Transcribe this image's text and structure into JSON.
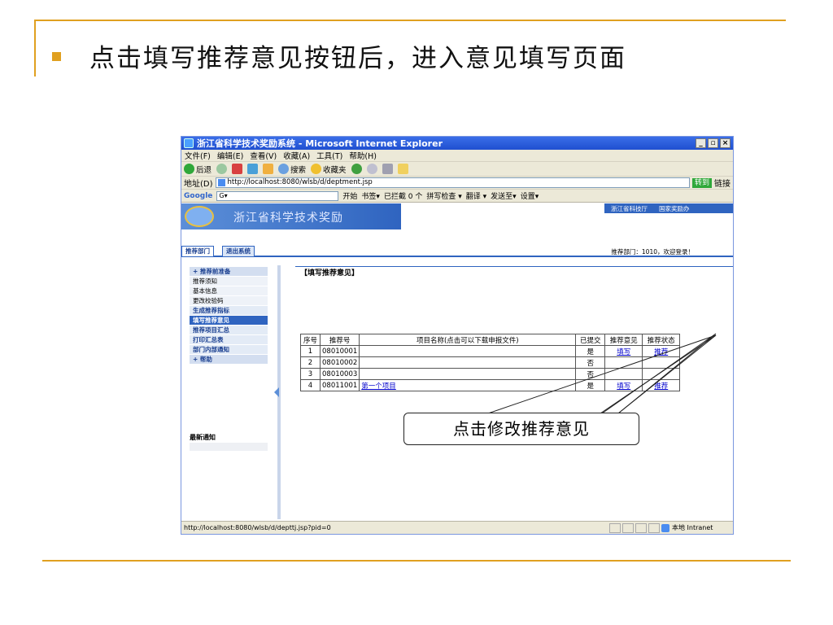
{
  "slide": {
    "heading": "点击填写推荐意见按钮后，进入意见填写页面"
  },
  "browser": {
    "window_title": "浙江省科学技术奖励系统 - Microsoft Internet Explorer",
    "menu": [
      "文件(F)",
      "编辑(E)",
      "查看(V)",
      "收藏(A)",
      "工具(T)",
      "帮助(H)"
    ],
    "toolbar": {
      "back": "后退",
      "search": "搜索",
      "favorites": "收藏夹"
    },
    "address_label": "地址(D)",
    "address_value": "http://localhost:8080/wlsb/d/deptment.jsp",
    "go_label": "转到",
    "links_label": "链接",
    "google": {
      "logo": "Google",
      "input": "G▾",
      "start": "开始",
      "bookmarks": "书签▾",
      "blocked": "已拦截 0 个",
      "spellcheck": "拼写检查 ▾",
      "translate": "翻译 ▾",
      "send": "发送至▾",
      "settings": "设置▾"
    },
    "status_url": "http://localhost:8080/wlsb/d/depttj.jsp?pid=0",
    "status_zone": "本地 Intranet"
  },
  "app": {
    "banner_title": "浙江省科学技术奖励",
    "banner_links": [
      "浙江省科技厅",
      "国家奖励办"
    ],
    "nav_tabs": [
      "推荐部门",
      "退出系统"
    ],
    "welcome": "推荐部门：1010，欢迎登录！",
    "sidebar": [
      {
        "label": "+ 推荐前准备",
        "style": "head"
      },
      {
        "label": "推荐须知",
        "style": "plain"
      },
      {
        "label": "基本信息",
        "style": "plain"
      },
      {
        "label": "更改校验码",
        "style": "plain"
      },
      {
        "label": "生成推荐指标",
        "style": "blue"
      },
      {
        "label": "填写推荐意见",
        "style": "active"
      },
      {
        "label": "推荐项目汇总",
        "style": "blue"
      },
      {
        "label": "打印汇总表",
        "style": "blue"
      },
      {
        "label": "部门内部通知",
        "style": "blue"
      },
      {
        "label": "+ 帮助",
        "style": "head"
      }
    ],
    "news_label": "最新通知",
    "form_title": "【填写推荐意见】",
    "table": {
      "headers": [
        "序号",
        "推荐号",
        "项目名称(点击可以下载申报文件)",
        "已提交",
        "推荐意见",
        "推荐状态"
      ],
      "rows": [
        {
          "no": "1",
          "id": "08010001",
          "name": "",
          "submitted": "是",
          "opinion": "填写",
          "status": "推荐"
        },
        {
          "no": "2",
          "id": "08010002",
          "name": "",
          "submitted": "否",
          "opinion": "",
          "status": ""
        },
        {
          "no": "3",
          "id": "08010003",
          "name": "",
          "submitted": "否",
          "opinion": "",
          "status": ""
        },
        {
          "no": "4",
          "id": "08011001",
          "name": "第一个项目",
          "submitted": "是",
          "opinion": "填写",
          "status": "推荐"
        }
      ]
    }
  },
  "callout": {
    "text": "点击修改推荐意见"
  },
  "colors": {
    "accent": "#e0a020",
    "app_blue": "#2f64c0",
    "link": "#0000cc"
  }
}
